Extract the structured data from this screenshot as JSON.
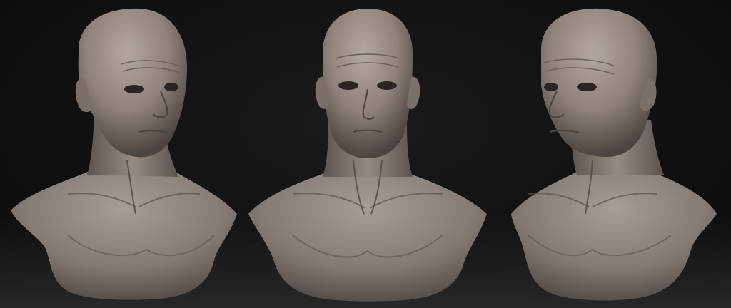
{
  "scene": {
    "background_color": "#121212",
    "floor_color": "#2c2c2c",
    "clay_color": "#8e827b",
    "clay_highlight": "#b3a8a1",
    "clay_shadow": "#4a433f"
  },
  "views": [
    {
      "id": "left",
      "facing": "three-quarter-right"
    },
    {
      "id": "center",
      "facing": "front"
    },
    {
      "id": "right",
      "facing": "three-quarter-left"
    }
  ]
}
